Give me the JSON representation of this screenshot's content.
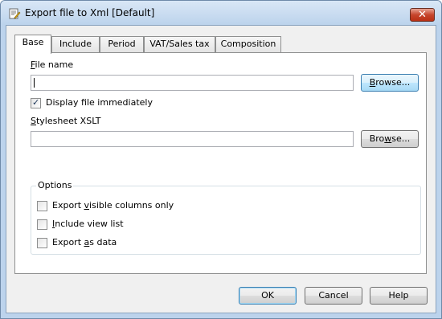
{
  "window": {
    "title": "Export file to Xml [Default]",
    "close_glyph": "✕"
  },
  "tabs": [
    {
      "label": "Base",
      "active": true
    },
    {
      "label": "Include",
      "active": false
    },
    {
      "label": "Period",
      "active": false
    },
    {
      "label": "VAT/Sales tax",
      "active": false
    },
    {
      "label": "Composition",
      "active": false
    }
  ],
  "base": {
    "file_name_accel": "F",
    "file_name_rest": "ile name",
    "file_name_value": "",
    "browse_accel": "B",
    "browse_rest": "rowse...",
    "display_immediately": {
      "label": "Display file immediately",
      "checked": true
    },
    "stylesheet_accel": "S",
    "stylesheet_rest": "tylesheet XSLT",
    "stylesheet_value": "",
    "browse2_accel": "w",
    "browse2_pre": "Bro",
    "browse2_post": "se...",
    "options_title": "Options",
    "export_visible": {
      "pre": "Export ",
      "accel": "v",
      "post": "isible columns only",
      "checked": false
    },
    "include_view": {
      "pre": "",
      "accel": "I",
      "post": "nclude view list",
      "checked": false
    },
    "export_data": {
      "pre": "Export ",
      "accel": "a",
      "post": "s data",
      "checked": false
    }
  },
  "buttons": {
    "ok": "OK",
    "cancel": "Cancel",
    "help": "Help"
  },
  "check_glyph": "✓",
  "icon": "edit-document-icon"
}
